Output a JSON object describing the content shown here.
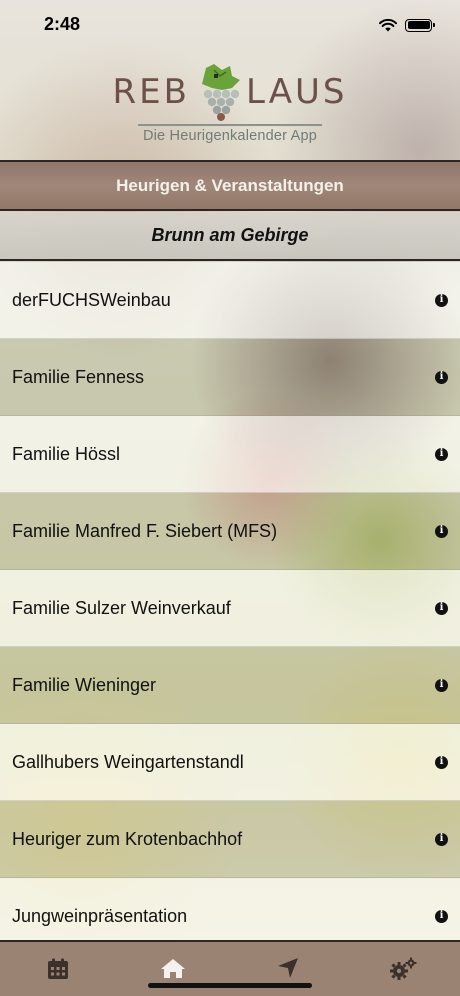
{
  "status_bar": {
    "time": "2:48"
  },
  "logo": {
    "left_word": "REB",
    "right_word": "LAUS",
    "subtitle": "Die Heurigenkalender App"
  },
  "header": {
    "section_title": "Heurigen & Veranstaltungen",
    "location_title": "Brunn am Gebirge"
  },
  "list": {
    "items": [
      {
        "label": "derFUCHSWeinbau",
        "info_icon": "info-circle-icon"
      },
      {
        "label": "Familie Fenness",
        "info_icon": "info-circle-icon"
      },
      {
        "label": "Familie Hössl",
        "info_icon": "info-circle-icon"
      },
      {
        "label": "Familie Manfred F. Siebert (MFS)",
        "info_icon": "info-circle-icon"
      },
      {
        "label": "Familie Sulzer Weinverkauf",
        "info_icon": "info-circle-icon"
      },
      {
        "label": "Familie Wieninger",
        "info_icon": "info-circle-icon"
      },
      {
        "label": "Gallhubers Weingartenstandl",
        "info_icon": "info-circle-icon"
      },
      {
        "label": "Heuriger zum Krotenbachhof",
        "info_icon": "info-circle-icon"
      },
      {
        "label": "Jungweinpräsentation",
        "info_icon": "info-circle-icon"
      }
    ]
  },
  "tab_bar": {
    "tabs": [
      {
        "icon": "calendar-icon",
        "active": false
      },
      {
        "icon": "home-icon",
        "active": true
      },
      {
        "icon": "location-arrow-icon",
        "active": false
      },
      {
        "icon": "gears-icon",
        "active": false
      }
    ]
  },
  "colors": {
    "header_brown": "#9a8373",
    "logo_brown": "#6b5148",
    "logo_subtitle": "#707c78",
    "leaf_green": "#6aa33a"
  }
}
